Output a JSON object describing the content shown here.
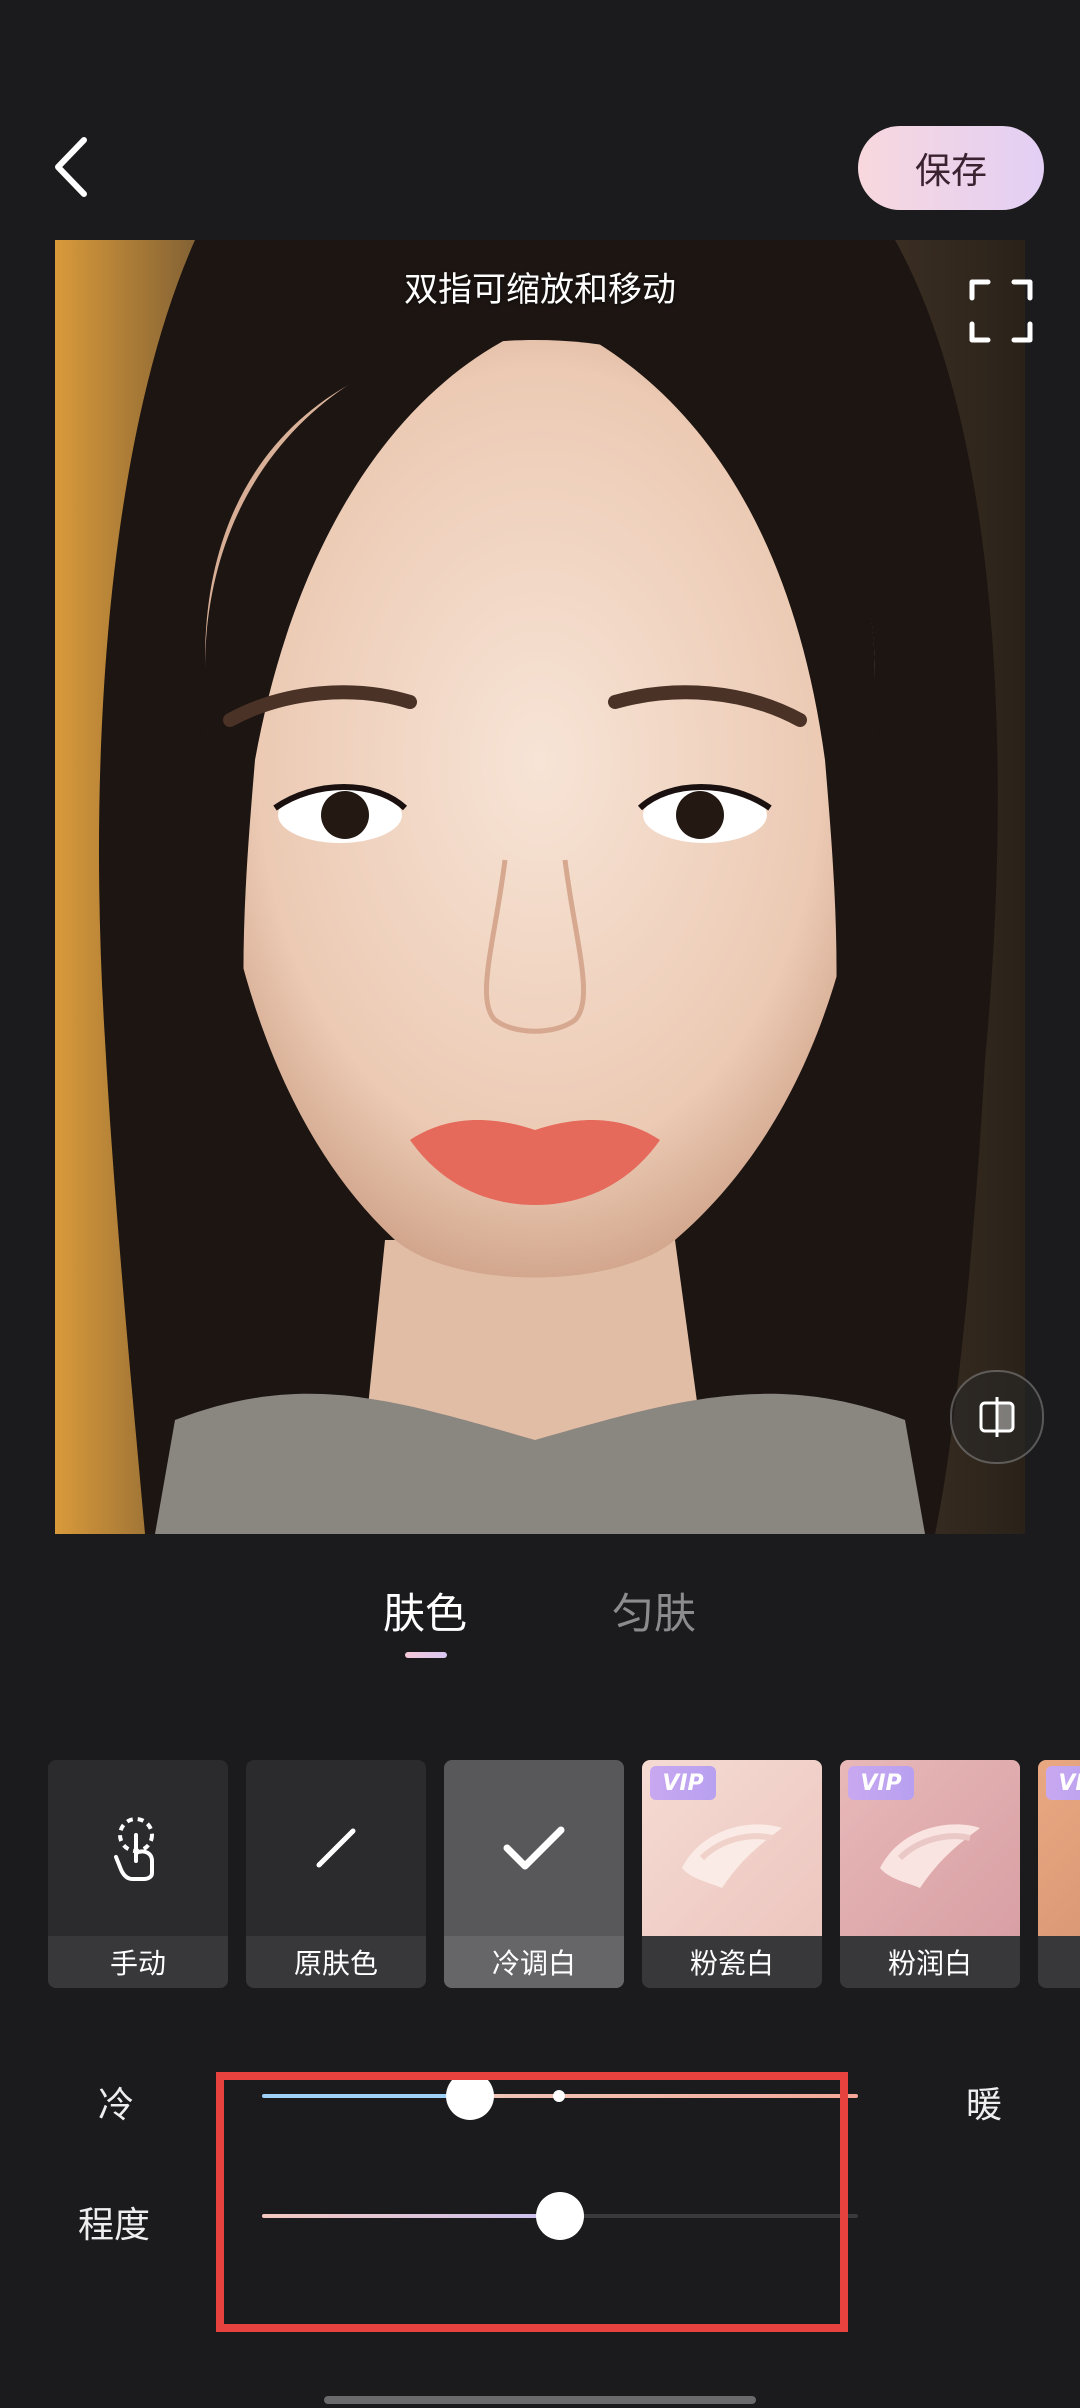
{
  "header": {
    "save_label": "保存"
  },
  "photo": {
    "hint": "双指可缩放和移动"
  },
  "tabs": [
    {
      "label": "肤色",
      "active": true
    },
    {
      "label": "匀肤",
      "active": false
    }
  ],
  "presets": [
    {
      "label": "手动",
      "icon": "hand-touch-icon",
      "vip": false
    },
    {
      "label": "原肤色",
      "icon": "slash-icon",
      "vip": false
    },
    {
      "label": "冷调白",
      "icon": "check-icon",
      "vip": false,
      "selected": true
    },
    {
      "label": "粉瓷白",
      "icon": "cream-swatch-icon",
      "vip": true
    },
    {
      "label": "粉润白",
      "icon": "cream-swatch-icon",
      "vip": true
    },
    {
      "label": "",
      "icon": "cream-swatch-icon",
      "vip": true
    }
  ],
  "vip_badge": "VIP",
  "sliders": {
    "temperature": {
      "left_label": "冷",
      "right_label": "暖",
      "value": 0.33,
      "default_marker": 0.5
    },
    "intensity": {
      "label": "程度",
      "value": 0.5
    }
  },
  "colors": {
    "accent_highlight": "#e8423f",
    "cool_track": "#9fd0f5",
    "warm_track": "#f5b9a8"
  }
}
